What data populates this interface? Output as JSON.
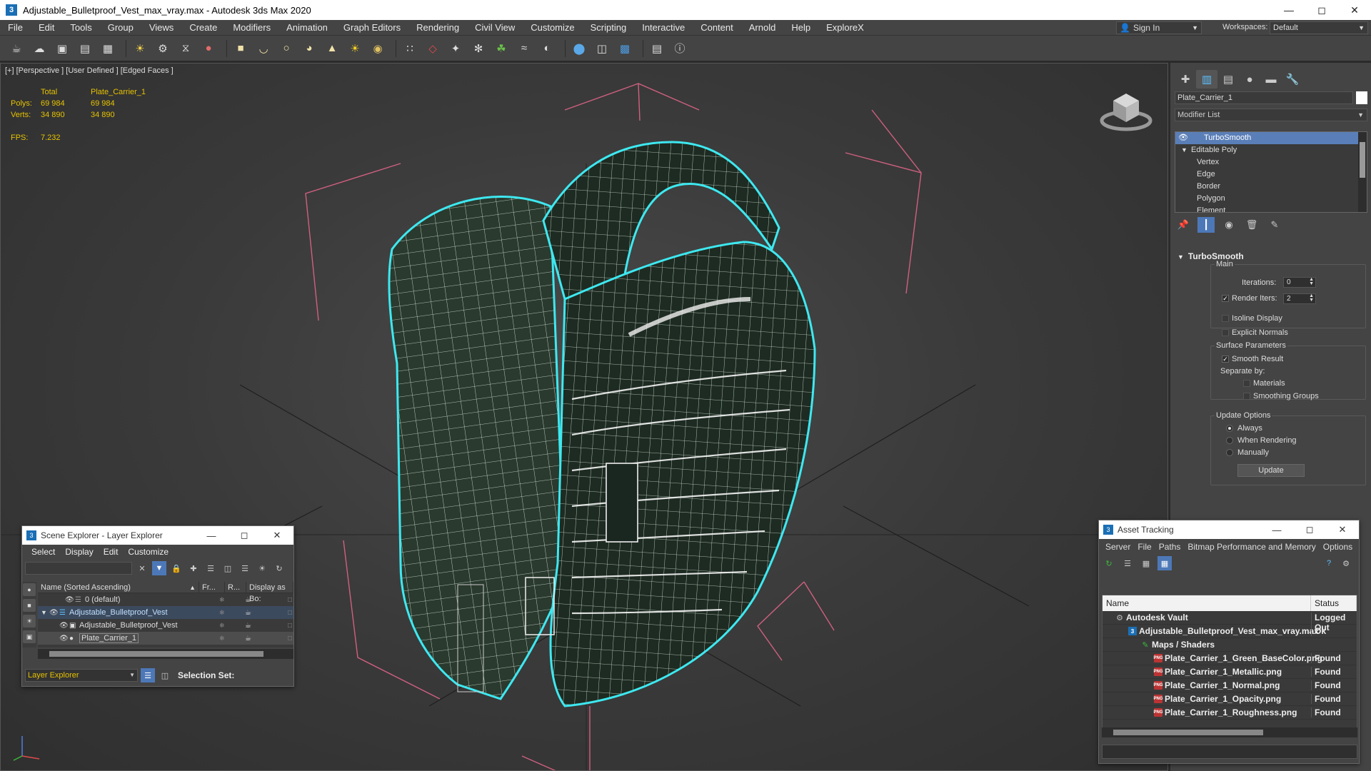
{
  "window": {
    "title": "Adjustable_Bulletproof_Vest_max_vray.max - Autodesk 3ds Max 2020",
    "app_icon": "3",
    "minimize_icon": "minimize-icon",
    "maximize_icon": "maximize-icon",
    "close_icon": "close-icon"
  },
  "menu": {
    "items": [
      "File",
      "Edit",
      "Tools",
      "Group",
      "Views",
      "Create",
      "Modifiers",
      "Animation",
      "Graph Editors",
      "Rendering",
      "Civil View",
      "Customize",
      "Scripting",
      "Interactive",
      "Content",
      "Arnold",
      "Help",
      "ExploreX"
    ],
    "sign_in": "Sign In",
    "workspaces_label": "Workspaces:",
    "workspace_value": "Default"
  },
  "toolbar": {
    "icons": [
      "teapot-icon",
      "cloud-icon",
      "render-frame-icon",
      "panel-icon",
      "grid-icon",
      "light-bulb-icon",
      "gear-cog-icon",
      "helix-icon",
      "spheres-icon",
      "box-icon",
      "dome-icon",
      "circle-icon",
      "bowl-icon",
      "cone-icon",
      "sun-icon",
      "disc-icon",
      "particles-icon",
      "capsule-icon",
      "geo-icon",
      "globe-icon",
      "plant-icon",
      "hair-icon",
      "shell-icon",
      "sphere-icon",
      "scene-icon",
      "cube-icon",
      "book-icon",
      "help-icon"
    ]
  },
  "viewport": {
    "label": "[+] [Perspective ] [User Defined ] [Edged Faces ]",
    "stats": {
      "header_total": "Total",
      "header_object": "Plate_Carrier_1",
      "polys_label": "Polys:",
      "polys_total": "69 984",
      "polys_object": "69 984",
      "verts_label": "Verts:",
      "verts_total": "34 890",
      "verts_object": "34 890",
      "fps_label": "FPS:",
      "fps_value": "7.232"
    }
  },
  "command_panel": {
    "tabs": [
      "create-icon",
      "modify-icon",
      "hierarchy-icon",
      "motion-icon",
      "display-icon",
      "utilities-icon"
    ],
    "object_name": "Plate_Carrier_1",
    "modifier_list": "Modifier List",
    "stack": [
      {
        "label": "TurboSmooth",
        "selected": true
      },
      {
        "label": "Editable Poly"
      },
      {
        "label": "Vertex"
      },
      {
        "label": "Edge"
      },
      {
        "label": "Border"
      },
      {
        "label": "Polygon"
      },
      {
        "label": "Element"
      }
    ],
    "rollout": {
      "title": "TurboSmooth",
      "main_label": "Main",
      "iterations_label": "Iterations:",
      "iterations_value": "0",
      "render_iters_label": "Render Iters:",
      "render_iters_value": "2",
      "render_iters_checked": true,
      "isoline_label": "Isoline Display",
      "explicit_normals_label": "Explicit Normals",
      "surface_title": "Surface Parameters",
      "smooth_result_label": "Smooth Result",
      "separate_by_label": "Separate by:",
      "materials_label": "Materials",
      "smoothing_groups_label": "Smoothing Groups",
      "update_title": "Update Options",
      "always_label": "Always",
      "when_rendering_label": "When Rendering",
      "manually_label": "Manually",
      "update_button": "Update"
    }
  },
  "scene_explorer": {
    "title": "Scene Explorer - Layer Explorer",
    "menu": [
      "Select",
      "Display",
      "Edit",
      "Customize"
    ],
    "columns": {
      "name": "Name (Sorted Ascending)",
      "sort_arrow": "▲",
      "frozen": "Fr...",
      "render": "R...",
      "display": "Display as Bo:"
    },
    "rows": [
      {
        "name": "0 (default)",
        "indent": 0
      },
      {
        "name": "Adjustable_Bulletproof_Vest",
        "indent": 0
      },
      {
        "name": "Adjustable_Bulletproof_Vest",
        "indent": 1
      },
      {
        "name": "Plate_Carrier_1",
        "indent": 1
      }
    ],
    "layer_dropdown": "Layer Explorer",
    "selection_set_label": "Selection Set:"
  },
  "asset_tracking": {
    "title": "Asset Tracking",
    "menu": [
      "Server",
      "File",
      "Paths",
      "Bitmap Performance and Memory",
      "Options"
    ],
    "columns": {
      "name": "Name",
      "status": "Status"
    },
    "rows": [
      {
        "name": "Autodesk Vault",
        "status": "Logged Out",
        "icon": "vault-icon",
        "indent": 1
      },
      {
        "name": "Adjustable_Bulletproof_Vest_max_vray.max",
        "status": "Ok",
        "icon": "max-file-icon",
        "indent": 2
      },
      {
        "name": "Maps / Shaders",
        "status": "",
        "icon": "maps-icon",
        "indent": 3
      },
      {
        "name": "Plate_Carrier_1_Green_BaseColor.png",
        "status": "Found",
        "icon": "png-icon",
        "indent": 4
      },
      {
        "name": "Plate_Carrier_1_Metallic.png",
        "status": "Found",
        "icon": "png-icon",
        "indent": 4
      },
      {
        "name": "Plate_Carrier_1_Normal.png",
        "status": "Found",
        "icon": "png-icon",
        "indent": 4
      },
      {
        "name": "Plate_Carrier_1_Opacity.png",
        "status": "Found",
        "icon": "png-icon",
        "indent": 4
      },
      {
        "name": "Plate_Carrier_1_Roughness.png",
        "status": "Found",
        "icon": "png-icon",
        "indent": 4
      }
    ]
  },
  "colors": {
    "selection_outline": "#3ee8f0",
    "stats_text": "#e6c200",
    "bbox_corner": "#d06080",
    "selected_row": "#5a7fb8"
  }
}
